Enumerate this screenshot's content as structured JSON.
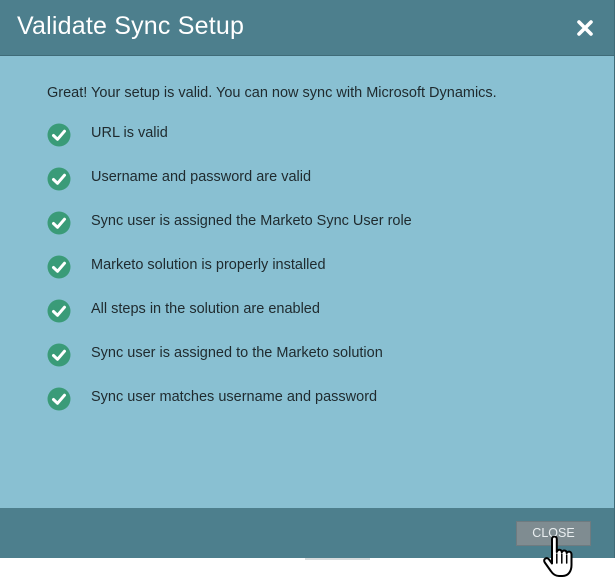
{
  "dialog": {
    "title": "Validate Sync Setup",
    "close_icon": "close-x-icon",
    "message": "Great! Your setup is valid. You can now sync with Microsoft Dynamics.",
    "checks": [
      {
        "label": "URL is valid",
        "icon": "check-circle-icon",
        "status": "valid"
      },
      {
        "label": "Username and password are valid",
        "icon": "check-circle-icon",
        "status": "valid"
      },
      {
        "label": "Sync user is assigned the Marketo Sync User role",
        "icon": "check-circle-icon",
        "status": "valid"
      },
      {
        "label": "Marketo solution is properly installed",
        "icon": "check-circle-icon",
        "status": "valid"
      },
      {
        "label": "All steps in the solution are enabled",
        "icon": "check-circle-icon",
        "status": "valid"
      },
      {
        "label": "Sync user is assigned to the Marketo solution",
        "icon": "check-circle-icon",
        "status": "valid"
      },
      {
        "label": "Sync user matches username and password",
        "icon": "check-circle-icon",
        "status": "valid"
      }
    ],
    "footer": {
      "close_label": "CLOSE"
    }
  },
  "colors": {
    "header_bg": "#4d7f8d",
    "body_bg": "#89c0d2",
    "check_green": "#3a9b78",
    "button_bg": "#7f8c91",
    "text": "#1f2a2e"
  },
  "cursor": "hand-pointer-icon"
}
